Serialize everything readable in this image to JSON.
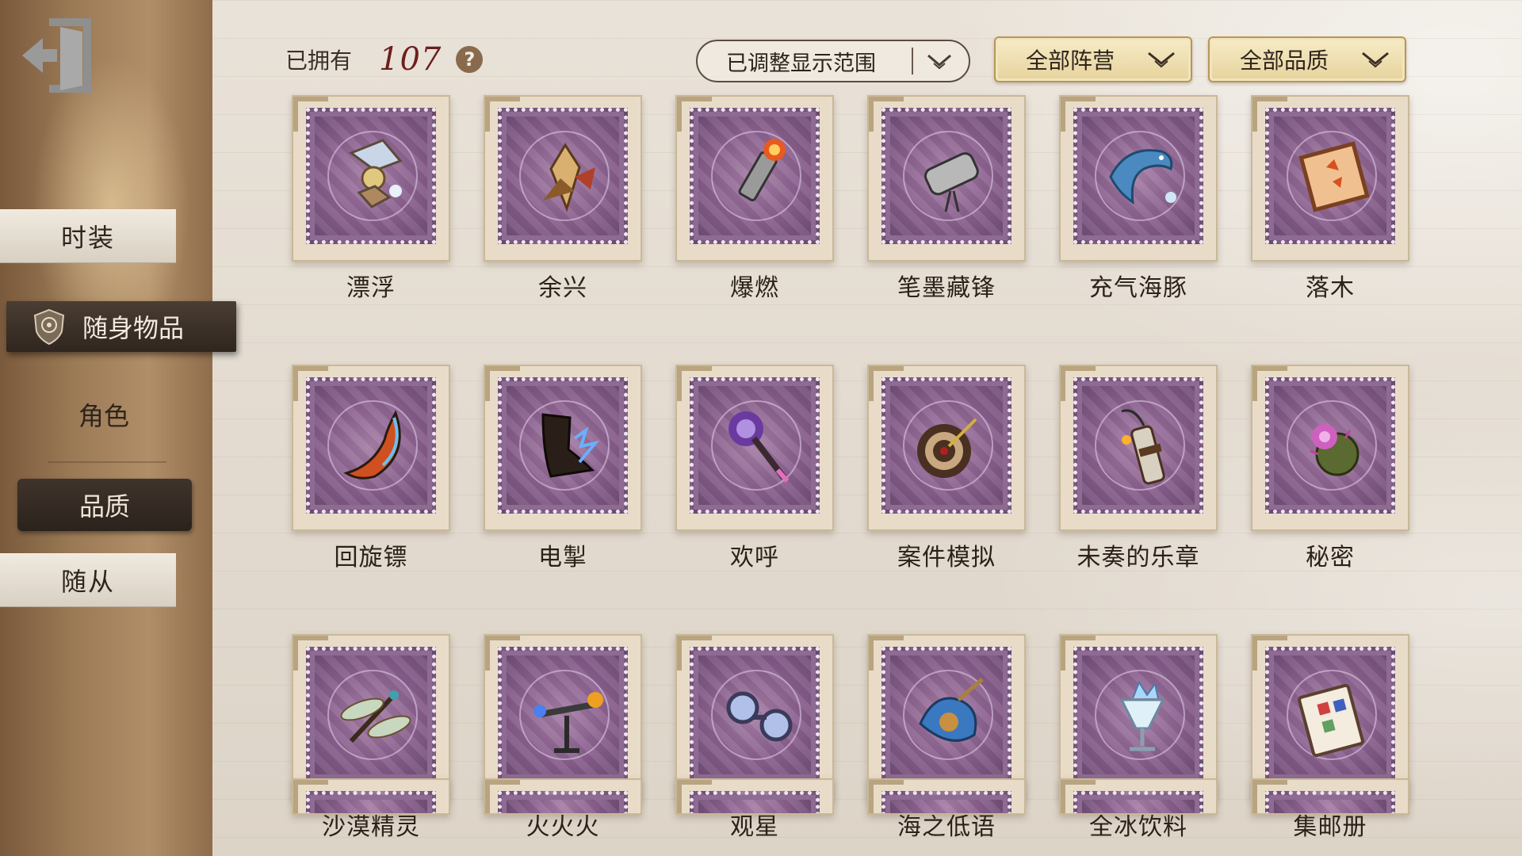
{
  "sidebar": {
    "exit_icon": "exit-door-icon",
    "items": [
      {
        "label": "时装"
      },
      {
        "label": "随身物品",
        "icon": "shield-badge-icon"
      },
      {
        "label": "角色"
      },
      {
        "label": "品质"
      },
      {
        "label": "随从"
      }
    ]
  },
  "header": {
    "owned_label": "已拥有",
    "owned_count": "107",
    "help_label": "?",
    "range_filter": "已调整显示范围",
    "faction_filter": "全部阵营",
    "quality_filter": "全部品质"
  },
  "items": [
    {
      "name": "漂浮",
      "icon": "floating-lantern-icon"
    },
    {
      "name": "余兴",
      "icon": "fan-bouquet-icon"
    },
    {
      "name": "爆燃",
      "icon": "flame-plug-icon"
    },
    {
      "name": "笔墨藏锋",
      "icon": "ink-scroll-icon"
    },
    {
      "name": "充气海豚",
      "icon": "dolphin-icon"
    },
    {
      "name": "落木",
      "icon": "leaf-frame-icon"
    },
    {
      "name": "回旋镖",
      "icon": "boomerang-icon"
    },
    {
      "name": "电掣",
      "icon": "lightning-boot-icon"
    },
    {
      "name": "欢呼",
      "icon": "pompom-wand-icon"
    },
    {
      "name": "案件模拟",
      "icon": "target-dart-icon"
    },
    {
      "name": "未奏的乐章",
      "icon": "dynamite-icon"
    },
    {
      "name": "秘密",
      "icon": "thorn-flower-icon"
    },
    {
      "name": "沙漠精灵",
      "icon": "dragonfly-icon"
    },
    {
      "name": "火火火",
      "icon": "torch-stand-icon"
    },
    {
      "name": "观星",
      "icon": "binoculars-icon"
    },
    {
      "name": "海之低语",
      "icon": "shell-icon"
    },
    {
      "name": "全冰饮料",
      "icon": "ice-drink-icon"
    },
    {
      "name": "集邮册",
      "icon": "stamp-album-icon"
    }
  ],
  "colors": {
    "count": "#6b1f1f",
    "stamp_purple": "#8c6390",
    "sidebar_active": "#2f261f",
    "gold_dropdown": "#e6d39c"
  }
}
